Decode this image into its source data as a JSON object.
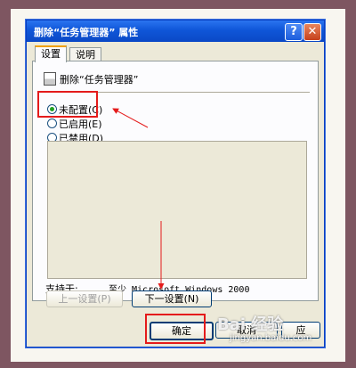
{
  "dialog": {
    "title": "删除“任务管理器” 属性",
    "help_glyph": "?",
    "close_glyph": "✕",
    "tabs": [
      {
        "label": "设置"
      },
      {
        "label": "说明"
      }
    ],
    "policy_name": "删除“任务管理器”",
    "options": [
      {
        "label": "未配置(C)",
        "checked": true
      },
      {
        "label": "已启用(E)",
        "checked": false
      },
      {
        "label": "已禁用(D)",
        "checked": false
      }
    ],
    "support_label": "支持于:",
    "support_value": "至少 Microsoft Windows 2000",
    "prev_button": "上一设置(P)",
    "next_button": "下一设置(N)",
    "ok_button": "确定",
    "cancel_button": "取消",
    "apply_button": "应"
  },
  "annotations": {
    "highlight_color": "#e41b1b"
  },
  "watermark": {
    "brand": "Bai 经验",
    "url": "jingyan.baidu.com"
  },
  "icons": [
    "policy-icon",
    "help-icon",
    "close-icon",
    "radio-selected-icon"
  ]
}
